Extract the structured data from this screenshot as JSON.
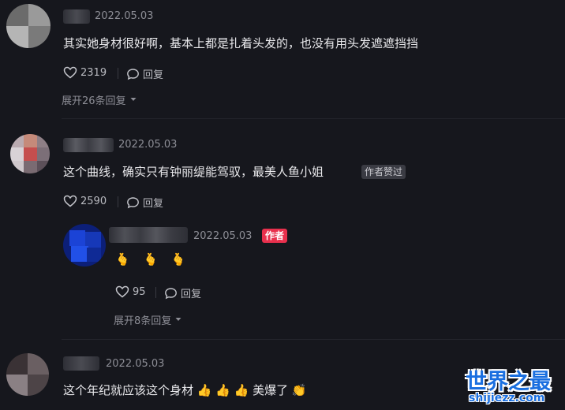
{
  "comments": [
    {
      "date": "2022.05.03",
      "text": "其实她身材很好啊，基本上都是扎着头发的，也没有用头发遮遮挡挡",
      "likes": "2319",
      "reply_label": "回复",
      "expand_label": "展开26条回复"
    },
    {
      "date": "2022.05.03",
      "text": "这个曲线，确实只有钟丽缇能驾驭，最美人鱼小姐",
      "badge": "作者赞过",
      "likes": "2590",
      "reply_label": "回复",
      "reply": {
        "date": "2022.05.03",
        "author_badge": "作者",
        "text": "🫰 🫰 🫰",
        "likes": "95",
        "reply_label": "回复"
      },
      "expand_label": "展开8条回复"
    },
    {
      "date": "2022.05.03",
      "text": "这个年纪就应该这个身材 👍 👍 👍 美爆了 👏"
    }
  ],
  "watermark": {
    "title": "世界之最",
    "url": "shijiezz.com"
  },
  "colors": {
    "background": "#16171d",
    "author_badge": "#e8304d",
    "watermark": "#1a6fe0"
  }
}
